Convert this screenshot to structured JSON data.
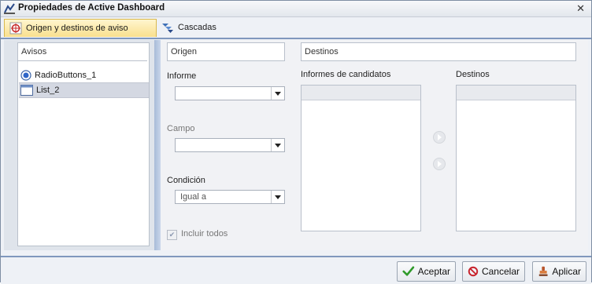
{
  "window": {
    "title": "Propiedades de Active Dashboard",
    "close_glyph": "✕"
  },
  "tabs": [
    {
      "label": "Origen y destinos de aviso",
      "icon": "target-icon",
      "active": true
    },
    {
      "label": "Cascadas",
      "icon": "cascade-icon",
      "active": false
    }
  ],
  "avisos": {
    "header": "Avisos",
    "items": [
      {
        "label": "RadioButtons_1",
        "icon": "radio-button-icon",
        "selected": false
      },
      {
        "label": "List_2",
        "icon": "list-icon",
        "selected": true
      }
    ]
  },
  "origen": {
    "header": "Origen",
    "informe_label": "Informe",
    "informe_value": "",
    "campo_label": "Campo",
    "campo_value": "",
    "condicion_label": "Condición",
    "condicion_value": "Igual a",
    "include_all_label": "Incluir todos",
    "include_all_checked": true
  },
  "destinos": {
    "header": "Destinos",
    "candidates_label": "Informes de candidatos",
    "targets_label": "Destinos"
  },
  "footer": {
    "accept_label": "Aceptar",
    "cancel_label": "Cancelar",
    "apply_label": "Aplicar"
  },
  "colors": {
    "accent": "#7f97bd",
    "active_tab": "#f9e08e",
    "selected_row": "#d4d8e2",
    "accept_check": "#2f9a2a",
    "cancel_red": "#c8232c"
  }
}
